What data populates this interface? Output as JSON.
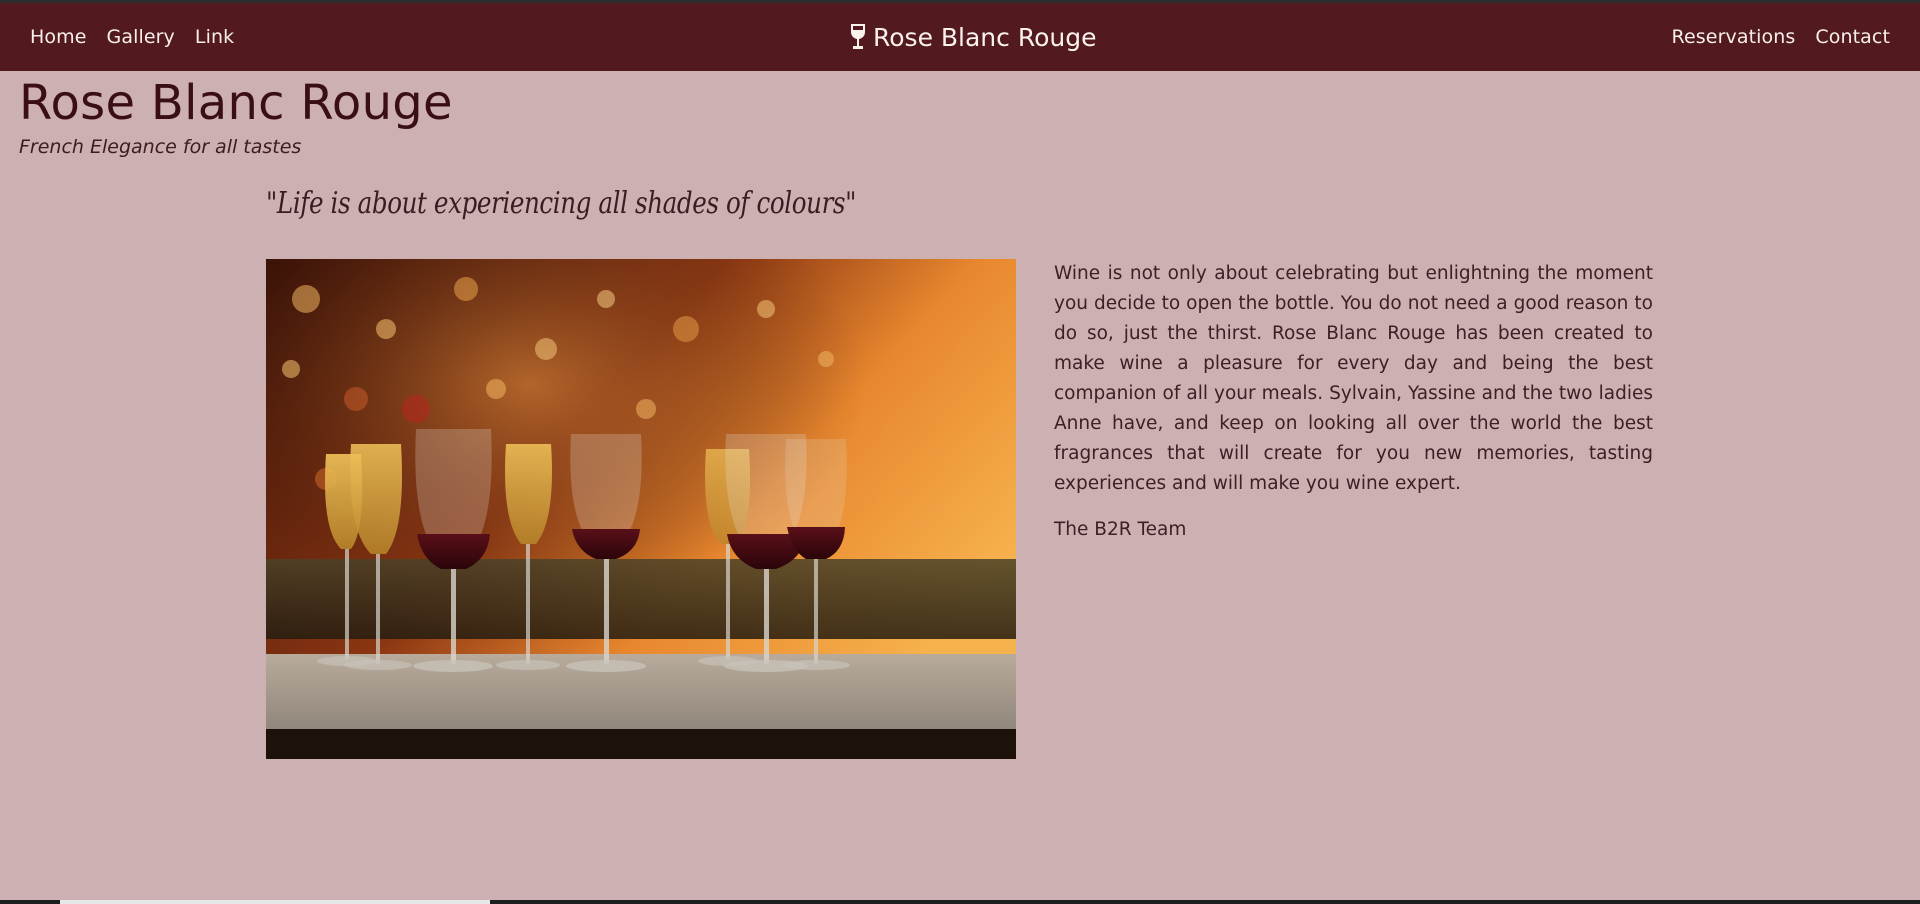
{
  "nav": {
    "left": [
      "Home",
      "Gallery",
      "Link"
    ],
    "right": [
      "Reservations",
      "Contact"
    ],
    "brand": "Rose Blanc Rouge",
    "brand_icon": "wine-glass-icon"
  },
  "header": {
    "title": "Rose Blanc Rouge",
    "subtitle": "French Elegance for all tastes"
  },
  "quote": "\"Life is about experiencing all shades of colours\"",
  "article": {
    "paragraph": "Wine is not only about celebrating but enlightning the moment you decide to open the bottle. You do not need a good reason to do so, just the thirst. Rose Blanc Rouge has been created to make wine a pleasure for every day and being the best companion of all your meals. Sylvain, Yassine and the two ladies Anne have, and keep on looking all over the world the best fragrances that will create for you new memories, tasting experiences and will make you wine expert.",
    "signature": "The B2R Team"
  },
  "colors": {
    "navbar": "#521a1f",
    "background": "#cdb0b2",
    "nav_text": "#f8efe9",
    "title_text": "#3a0f14"
  }
}
